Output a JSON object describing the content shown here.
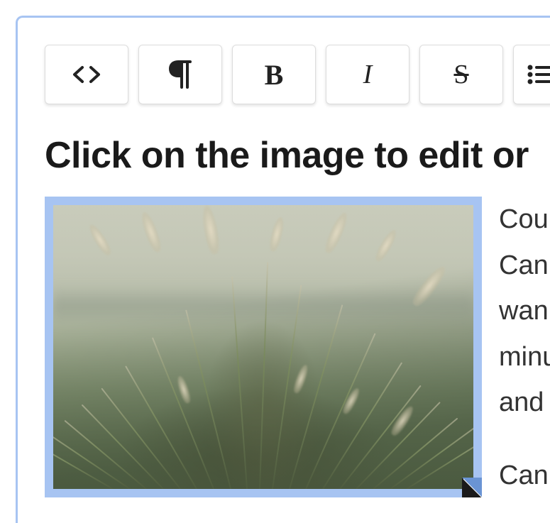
{
  "toolbar": {
    "code": "code-view",
    "paragraph": "paragraph",
    "bold": "bold",
    "italic": "italic",
    "strike": "strikethrough",
    "list": "unordered-list"
  },
  "heading": "Click on the image to edit or",
  "image": {
    "alt": "Ornamental grass with feathery seed heads in soft backlight",
    "selected": true
  },
  "body": {
    "line1": "Could",
    "line2": "Can v",
    "line3": "wann",
    "line4": "minu",
    "line5": "and u",
    "line6": "Can y"
  }
}
